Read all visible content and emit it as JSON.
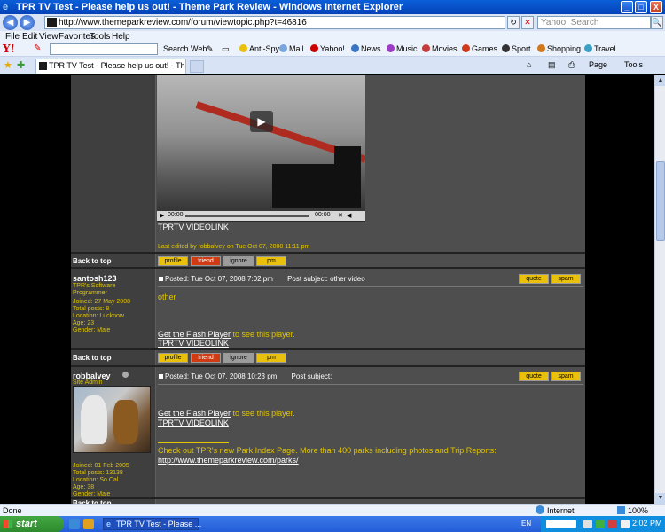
{
  "window": {
    "title": "TPR TV Test - Please help us out! - Theme Park Review - Windows Internet Explorer",
    "minimize": "_",
    "maximize": "□",
    "close": "X"
  },
  "address": {
    "url": "http://www.themeparkreview.com/forum/viewtopic.php?t=46816",
    "search_placeholder": "Yahoo! Search",
    "back": "◀",
    "forward": "▶",
    "refresh": "↻",
    "stop": "✕",
    "go": "🔍"
  },
  "menu": [
    "File",
    "Edit",
    "View",
    "Favorites",
    "Tools",
    "Help"
  ],
  "yahoo_toolbar": {
    "logo": "Y!",
    "search_web": "Search Web",
    "items": [
      "Anti-Spy",
      "Mail",
      "Yahoo!",
      "News",
      "Music",
      "Movies",
      "Games",
      "Sport",
      "Shopping",
      "Travel"
    ]
  },
  "tabs": {
    "active_tab": "TPR TV Test - Please help us out! - Theme Park Review",
    "page_cmd": "Page",
    "tools_cmd": "Tools"
  },
  "video": {
    "time_start": "00:00",
    "time_end": "00:00"
  },
  "post1": {
    "video_link": "TPRTV VIDEOLINK",
    "last_edited": "Last edited by robbalvey on Tue Oct 07, 2008 11:11 pm"
  },
  "back_to_top": "Back to top",
  "buttons": {
    "profile": "profile",
    "friend": "friend",
    "ignore": "ignore",
    "pm": "pm",
    "quote": "quote",
    "spam": "spam"
  },
  "post2": {
    "username": "santosh123",
    "rank_line1": "TPR's Software",
    "rank_line2": "Programmer",
    "joined": "Joined: 27 May 2008",
    "total_posts": "Total posts: 8",
    "location": "Location: Lucknow",
    "age": "Age: 23",
    "gender": "Gender: Male",
    "posted": "Posted: Tue Oct 07, 2008 7:02 pm",
    "subject": "Post subject: other video",
    "body": "other",
    "flash_link": "Get the Flash Player",
    "flash_rest": " to see this player.",
    "video_link": "TPRTV VIDEOLINK"
  },
  "post3": {
    "username": "robbalvey",
    "rank": "Site Admin",
    "joined": "Joined: 01 Feb 2005",
    "total_posts": "Total posts: 13138",
    "location": "Location: So Cal",
    "age": "Age: 38",
    "gender": "Gender: Male",
    "posted": "Posted: Tue Oct 07, 2008 10:23 pm",
    "subject": "Post subject:",
    "flash_link": "Get the Flash Player",
    "flash_rest": " to see this player.",
    "video_link": "TPRTV VIDEOLINK",
    "sig_text": "Check out TPR's new Park Index Page. More than 400 parks including photos and Trip Reports:",
    "sig_link": "http://www.themeparkreview.com/parks/"
  },
  "status": {
    "left": "Done",
    "zone": "Internet",
    "zoom": "100%"
  },
  "taskbar": {
    "start": "start",
    "task": "TPR TV Test - Please ...",
    "lang": "EN",
    "clock": "2:02 PM"
  },
  "colors": {
    "link_yellow": "#e0c400",
    "forum_bg": "#4e4e4e",
    "taskbar_blue": "#245dd8"
  }
}
